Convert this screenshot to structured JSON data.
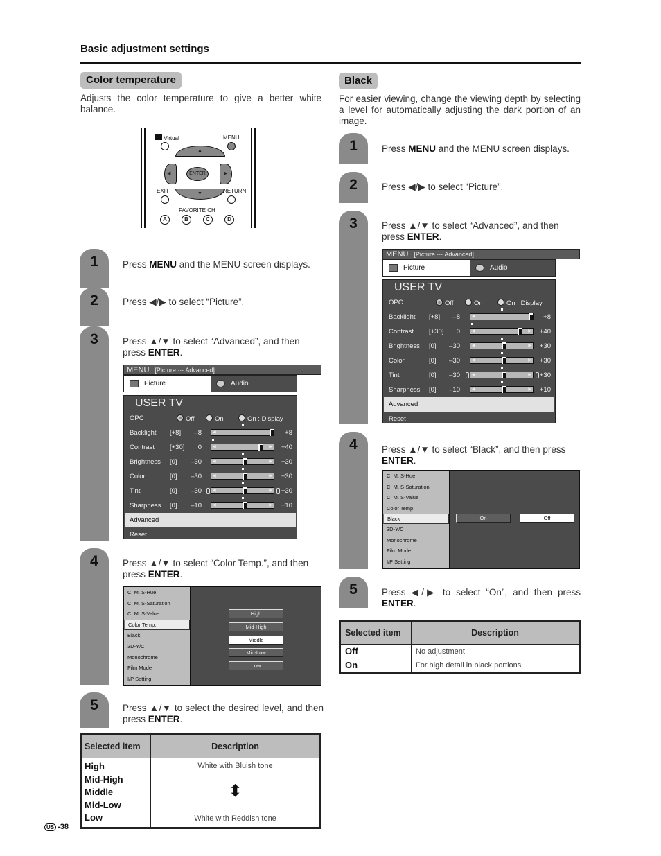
{
  "header": {
    "section_title": "Basic adjustment settings"
  },
  "left": {
    "pill": "Color temperature",
    "intro": "Adjusts the color temperature to give a better white balance.",
    "remote": {
      "labels": {
        "virtual": "Virtual",
        "menu": "MENU",
        "enter": "ENTER",
        "exit": "EXIT",
        "return": "RETURN",
        "favorite": "FAVORITE CH",
        "a": "A",
        "b": "B",
        "c": "C",
        "d": "D"
      }
    },
    "steps": [
      {
        "num": "1",
        "pre": "Press ",
        "bold": "MENU",
        "post": " and the MENU screen displays."
      },
      {
        "num": "2",
        "pre": "Press ◀/▶ to select “Picture”.",
        "bold": "",
        "post": ""
      },
      {
        "num": "3",
        "pre": "Press ▲/▼ to select “Advanced”, and then press ",
        "bold": "ENTER",
        "post": "."
      },
      {
        "num": "4",
        "pre": "Press ▲/▼ to select “Color Temp.”, and then press ",
        "bold": "ENTER",
        "post": "."
      },
      {
        "num": "5",
        "pre": "Press ▲/▼ to select the desired level, and then press ",
        "bold": "ENTER",
        "post": "."
      }
    ],
    "adv_options": [
      "High",
      "Mid-High",
      "Middle",
      "Mid-Low",
      "Low"
    ],
    "adv_selected_option": "Middle",
    "table": {
      "headers": [
        "Selected item",
        "Description"
      ],
      "items": [
        "High",
        "Mid-High",
        "Middle",
        "Mid-Low",
        "Low"
      ],
      "desc_top": "White with Bluish tone",
      "desc_bottom": "White with Reddish tone"
    }
  },
  "right": {
    "pill": "Black",
    "intro": "For easier viewing, change the viewing depth by selecting a level for automatically adjusting the dark portion of an image.",
    "steps": [
      {
        "num": "1",
        "pre": "Press ",
        "bold": "MENU",
        "post": " and the MENU screen displays."
      },
      {
        "num": "2",
        "pre": "Press ◀/▶ to select “Picture”.",
        "bold": "",
        "post": ""
      },
      {
        "num": "3",
        "pre": "Press ▲/▼ to select “Advanced”, and then press ",
        "bold": "ENTER",
        "post": "."
      },
      {
        "num": "4",
        "pre": "Press ▲/▼ to select “Black”, and then press ",
        "bold": "ENTER",
        "post": "."
      },
      {
        "num": "5",
        "pre": "Press ◀/▶ to select “On”, and then press ",
        "bold": "ENTER",
        "post": "."
      }
    ],
    "adv_options": [
      "On",
      "Off"
    ],
    "adv_selected_option": "Off",
    "table": {
      "headers": [
        "Selected item",
        "Description"
      ],
      "rows": [
        {
          "item": "Off",
          "desc": "No adjustment"
        },
        {
          "item": "On",
          "desc": "For high detail in black portions"
        }
      ]
    }
  },
  "menu_screen": {
    "bar_title": "MENU",
    "breadcrumb": "[Picture ··· Advanced]",
    "tabs": [
      "Picture",
      "Audio"
    ],
    "panel_title": "USER TV",
    "opc": {
      "label": "OPC",
      "options": [
        "Off",
        "On",
        "On : Display"
      ],
      "selected": "Off"
    },
    "sliders": [
      {
        "label": "Backlight",
        "current": "[+8]",
        "min_label": "–8",
        "max_label": "+8",
        "min": -8,
        "max": 8,
        "value": 8
      },
      {
        "label": "Contrast",
        "current": "[+30]",
        "min_label": "0",
        "max_label": "+40",
        "min": 0,
        "max": 40,
        "value": 30
      },
      {
        "label": "Brightness",
        "current": "[0]",
        "min_label": "–30",
        "max_label": "+30",
        "min": -30,
        "max": 30,
        "value": 0
      },
      {
        "label": "Color",
        "current": "[0]",
        "min_label": "–30",
        "max_label": "+30",
        "min": -30,
        "max": 30,
        "value": 0
      },
      {
        "label": "Tint",
        "current": "[0]",
        "min_label": "–30",
        "max_label": "+30",
        "min": -30,
        "max": 30,
        "value": 0
      },
      {
        "label": "Sharpness",
        "current": "[0]",
        "min_label": "–10",
        "max_label": "+10",
        "min": -10,
        "max": 10,
        "value": 0
      }
    ],
    "advanced_label": "Advanced",
    "reset_label": "Reset"
  },
  "advanced_menu": {
    "items": [
      "C. M. S-Hue",
      "C. M. S-Saturation",
      "C. M. S-Value",
      "Color Temp.",
      "Black",
      "3D-Y/C",
      "Monochrome",
      "Film Mode",
      "I/P Setting"
    ]
  },
  "footer": {
    "region": "US",
    "page": "-38"
  }
}
